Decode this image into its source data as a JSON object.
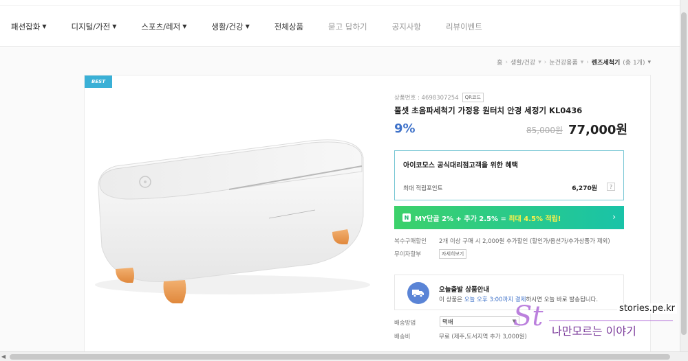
{
  "nav": {
    "items": [
      {
        "label": "패션잡화",
        "caret": true,
        "muted": false
      },
      {
        "label": "디지털/가전",
        "caret": true,
        "muted": false
      },
      {
        "label": "스포츠/레저",
        "caret": true,
        "muted": false
      },
      {
        "label": "생활/건강",
        "caret": true,
        "muted": false
      },
      {
        "label": "전체상품",
        "caret": false,
        "muted": false
      },
      {
        "label": "묻고 답하기",
        "caret": false,
        "muted": true
      },
      {
        "label": "공지사항",
        "caret": false,
        "muted": true
      },
      {
        "label": "리뷰이벤트",
        "caret": false,
        "muted": true
      }
    ]
  },
  "breadcrumb": {
    "home": "홈",
    "level1": "생활/건강",
    "level2": "눈건강용품",
    "current": "렌즈세척기",
    "count": "(총 1개)"
  },
  "product": {
    "badge": "BEST",
    "code_label": "상품번호 : 4698307254",
    "qr_label": "QR코드",
    "title": "풀셋 초음파세척기 가정용 원터치 안경 세정기 KL0436",
    "discount": "9%",
    "original_price": "85,000원",
    "price": "77,000원"
  },
  "benefit": {
    "title": "아이코모스 공식대리점고객을 위한 혜택",
    "point_label": "최대 적립포인트",
    "point_value": "6,270원",
    "help": "?"
  },
  "npay": {
    "badge": "N",
    "text_prefix": "MY단골 2% + 추가 2.5% = ",
    "text_highlight": "최대 4.5% 적립!",
    "arrow": "›"
  },
  "rows": {
    "multi_label": "복수구매할인",
    "multi_value": "2개 이상 구매 시 2,000원 추가할인 (할인가/옵션가/추가상품가 제외)",
    "installment_label": "무이자할부",
    "installment_btn": "자세히보기"
  },
  "shipping": {
    "title": "오늘출발 상품안내",
    "desc_prefix": "이 상품은 ",
    "desc_highlight": "오늘 오후 3:00까지 결제",
    "desc_suffix": "하시면 오늘 바로 발송됩니다.",
    "method_label": "배송방법",
    "method_value": "택배",
    "fee_label": "배송비",
    "fee_value": "무료 (제주,도서지역 추가 3,000원)"
  },
  "watermark": {
    "site": "stories.pe.kr",
    "logo": "St",
    "text": "나만모르는 이야기"
  },
  "colors": {
    "accent_blue": "#3f72c9",
    "npay_green": "#3cd16a",
    "benefit_border": "#76c6d4",
    "badge_blue": "#3ab0d6"
  }
}
